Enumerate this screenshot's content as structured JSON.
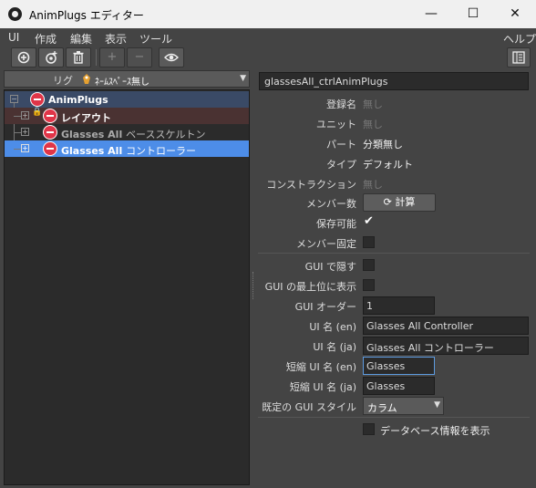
{
  "window": {
    "title": "AnimPlugs エディター",
    "minimize": "—",
    "maximize": "☐",
    "close": "✕",
    "app_icon": "animplugs-logo-icon"
  },
  "menu": {
    "items": [
      "UI",
      "作成",
      "編集",
      "表示",
      "ツール"
    ],
    "help": "ヘルプ"
  },
  "toolbar": {
    "buttons": [
      "add-node-icon",
      "add-target-icon",
      "trash-icon",
      "plus-icon",
      "minus-icon",
      "eye-icon"
    ],
    "plus_label": "+",
    "minus_label": "−",
    "right_icon": "panel-toggle-icon"
  },
  "rig": {
    "label": "リグ",
    "value": "ﾈｰﾑｽﾍﾟｰｽ無し"
  },
  "tree": {
    "root": "AnimPlugs",
    "items": [
      {
        "name": "レイアウト",
        "sub": "",
        "locked": true,
        "selected": false
      },
      {
        "name": "Glasses All",
        "sub": "ベーススケルトン",
        "locked": false,
        "selected": false
      },
      {
        "name": "Glasses All",
        "sub": "コントローラー",
        "locked": false,
        "selected": true
      }
    ]
  },
  "props": {
    "node_name": "glassesAll_ctrlAnimPlugs",
    "registered_name_label": "登録名",
    "registered_name_value": "無し",
    "unit_label": "ユニット",
    "unit_value": "無し",
    "part_label": "パート",
    "part_value": "分類無し",
    "type_label": "タイプ",
    "type_value": "デフォルト",
    "construction_label": "コンストラクション",
    "construction_value": "無し",
    "members_label": "メンバー数",
    "calc_button": "計算",
    "saveable_label": "保存可能",
    "saveable_checked": true,
    "member_lock_label": "メンバー固定",
    "member_lock_checked": false,
    "gui_hide_label": "GUI で隠す",
    "gui_hide_checked": false,
    "gui_top_label": "GUI の最上位に表示",
    "gui_top_checked": false,
    "gui_order_label": "GUI オーダー",
    "gui_order_value": "1",
    "ui_name_en_label": "UI 名 (en)",
    "ui_name_en_value": "Glasses All Controller",
    "ui_name_ja_label": "UI 名 (ja)",
    "ui_name_ja_value": "Glasses All コントローラー",
    "short_ui_en_label": "短縮 UI 名 (en)",
    "short_ui_en_value": "Glasses",
    "short_ui_ja_label": "短縮 UI 名 (ja)",
    "short_ui_ja_value": "Glasses",
    "gui_style_label": "既定の GUI スタイル",
    "gui_style_value": "カラム",
    "db_info_label": "データベース情報を表示",
    "db_info_checked": false
  },
  "colors": {
    "accent": "#5d9be0",
    "selection": "#4d8de8",
    "node_red": "#e03548"
  }
}
